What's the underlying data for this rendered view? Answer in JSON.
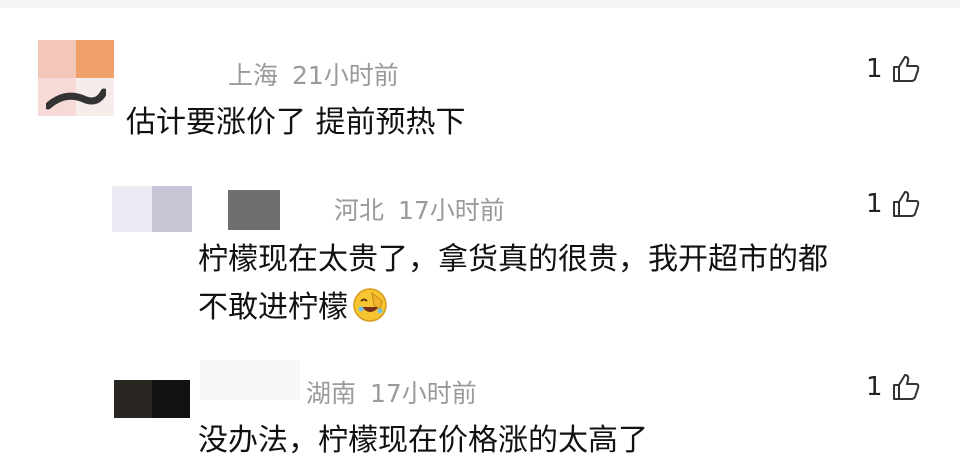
{
  "comments": [
    {
      "location": "上海",
      "time": "21小时前",
      "text_lines": [
        "估计要涨价了 提前预热下"
      ],
      "likes": "1"
    },
    {
      "location": "河北",
      "time": "17小时前",
      "text_lines": [
        "柠檬现在太贵了，拿货真的很贵，我开超市的都",
        "不敢进柠檬"
      ],
      "likes": "1",
      "emoji": "facepalm-laugh-emoji"
    },
    {
      "location": "湖南",
      "time": "17小时前",
      "text_lines": [
        "没办法，柠檬现在价格涨的太高了"
      ],
      "likes": "1"
    }
  ],
  "colors": {
    "meta_text": "#9a9a9a",
    "body_text": "#111111",
    "background": "#ffffff"
  },
  "icons": [
    "thumbs-up-icon"
  ]
}
